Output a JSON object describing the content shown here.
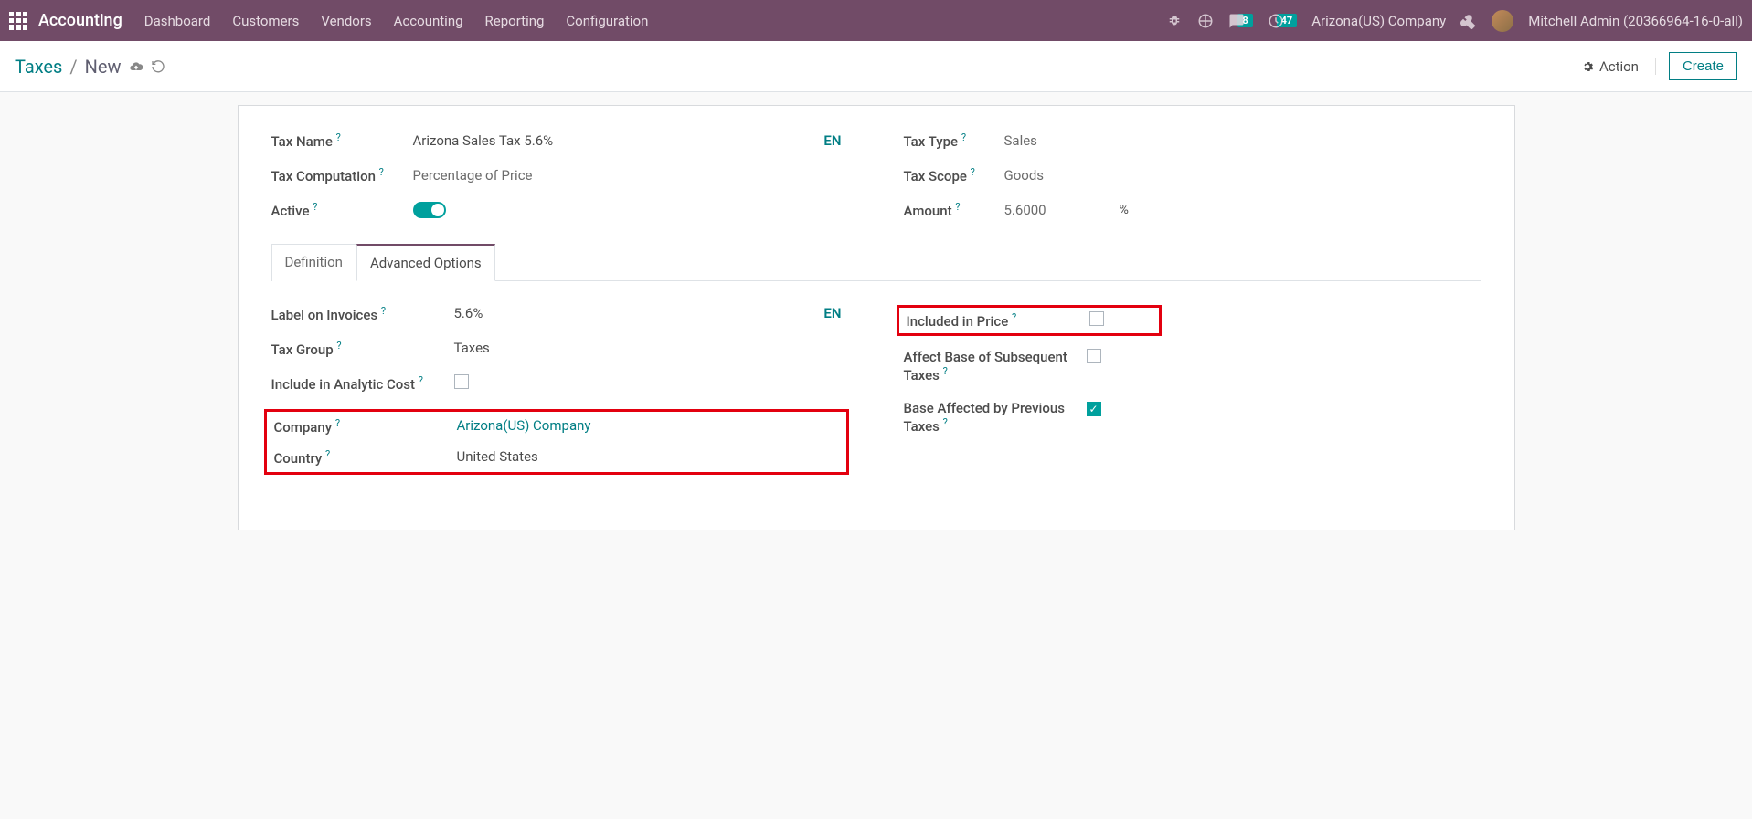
{
  "nav": {
    "brand": "Accounting",
    "menu": [
      "Dashboard",
      "Customers",
      "Vendors",
      "Accounting",
      "Reporting",
      "Configuration"
    ],
    "msg_count": "8",
    "clock_count": "47",
    "company": "Arizona(US) Company",
    "user": "Mitchell Admin (20366964-16-0-all)"
  },
  "breadcrumb": {
    "parent": "Taxes",
    "current": "New"
  },
  "buttons": {
    "action": "Action",
    "create": "Create"
  },
  "form": {
    "tax_name_label": "Tax Name",
    "tax_name_value": "Arizona Sales Tax 5.6%",
    "lang": "EN",
    "tax_type_label": "Tax Type",
    "tax_type_value": "Sales",
    "tax_computation_label": "Tax Computation",
    "tax_computation_value": "Percentage of Price",
    "tax_scope_label": "Tax Scope",
    "tax_scope_value": "Goods",
    "active_label": "Active",
    "amount_label": "Amount",
    "amount_value": "5.6000",
    "amount_unit": "%"
  },
  "tabs": {
    "definition": "Definition",
    "advanced": "Advanced Options"
  },
  "adv": {
    "label_invoices_label": "Label on Invoices",
    "label_invoices_value": "5.6%",
    "lang": "EN",
    "tax_group_label": "Tax Group",
    "tax_group_value": "Taxes",
    "include_analytic_label": "Include in Analytic Cost",
    "company_label": "Company",
    "company_value": "Arizona(US) Company",
    "country_label": "Country",
    "country_value": "United States",
    "included_price_label": "Included in Price",
    "affect_base_label": "Affect Base of Subsequent Taxes",
    "base_affected_label": "Base Affected by Previous Taxes"
  }
}
